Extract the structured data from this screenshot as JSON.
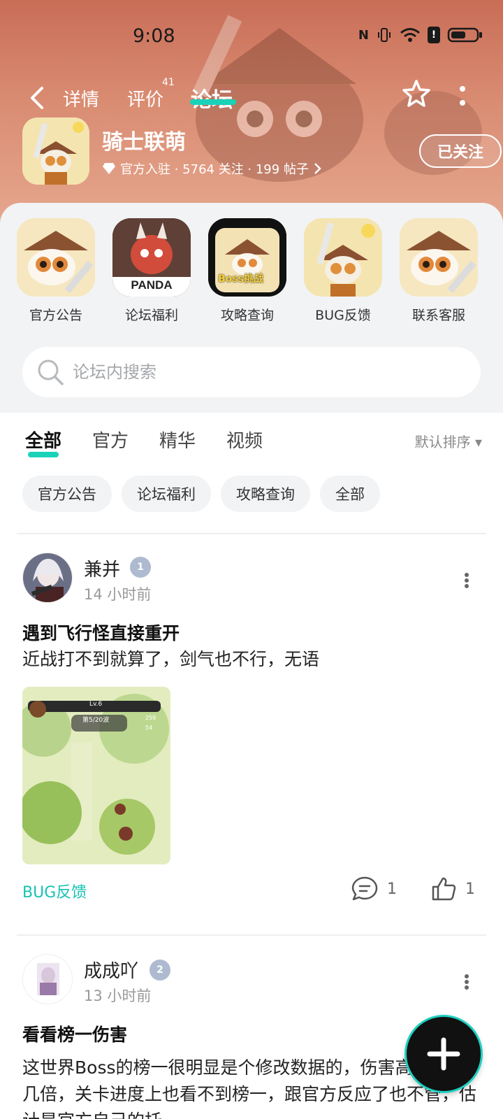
{
  "status": {
    "time": "9:08"
  },
  "nav": {
    "tabs": [
      {
        "label": "详情"
      },
      {
        "label": "评价",
        "badge": "41"
      },
      {
        "label": "论坛"
      }
    ]
  },
  "game": {
    "name": "骑士联萌",
    "meta": "官方入驻 · 5764 关注 · 199 帖子",
    "follow_label": "已关注"
  },
  "quick_links": [
    {
      "label": "官方公告"
    },
    {
      "label": "论坛福利",
      "icon_text": "PANDA"
    },
    {
      "label": "攻略查询",
      "icon_text": "Boss挑战"
    },
    {
      "label": "BUG反馈"
    },
    {
      "label": "联系客服"
    }
  ],
  "search": {
    "placeholder": "论坛内搜索"
  },
  "filter_tabs": [
    {
      "label": "全部"
    },
    {
      "label": "官方"
    },
    {
      "label": "精华"
    },
    {
      "label": "视频"
    }
  ],
  "sort_label": "默认排序 ▾",
  "chips": [
    {
      "label": "官方公告"
    },
    {
      "label": "论坛福利"
    },
    {
      "label": "攻略查询"
    },
    {
      "label": "全部"
    }
  ],
  "posts": [
    {
      "author": "兼并",
      "level": "1",
      "time": "14 小时前",
      "title": "遇到飞行怪直接重开",
      "body": "近战打不到就算了，剑气也不行，无语",
      "image_texts": {
        "level": "Lv.6",
        "wave": "第5/20波",
        "coin": "259",
        "gem": "54"
      },
      "tag": "BUG反馈",
      "comments": "1",
      "likes": "1"
    },
    {
      "author": "成成吖",
      "level": "2",
      "time": "13 小时前",
      "title": "看看榜一伤害",
      "body": "这世界Boss的榜一很明显是个修改数据的，伤害高我们十几倍，关卡进度上也看不到榜一，跟官方反应了也不管，估计是官方自己的托"
    }
  ]
}
